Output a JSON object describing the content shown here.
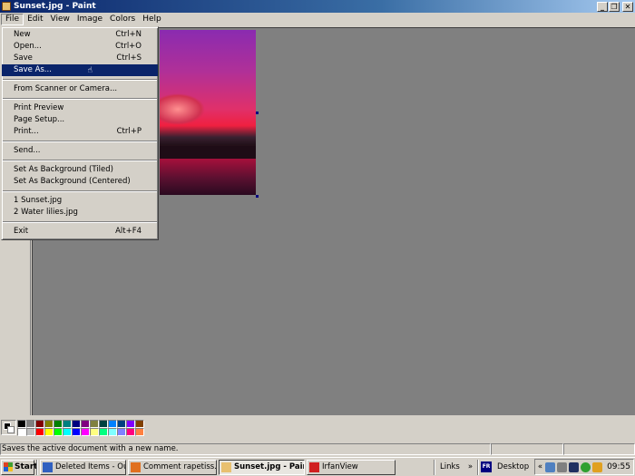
{
  "window": {
    "title": "Sunset.jpg - Paint"
  },
  "menubar": [
    "File",
    "Edit",
    "View",
    "Image",
    "Colors",
    "Help"
  ],
  "file_menu": {
    "groups": [
      [
        {
          "label": "New",
          "shortcut": "Ctrl+N"
        },
        {
          "label": "Open...",
          "shortcut": "Ctrl+O"
        },
        {
          "label": "Save",
          "shortcut": "Ctrl+S"
        },
        {
          "label": "Save As...",
          "shortcut": "",
          "highlighted": true
        }
      ],
      [
        {
          "label": "From Scanner or Camera...",
          "shortcut": ""
        }
      ],
      [
        {
          "label": "Print Preview",
          "shortcut": ""
        },
        {
          "label": "Page Setup...",
          "shortcut": ""
        },
        {
          "label": "Print...",
          "shortcut": "Ctrl+P"
        }
      ],
      [
        {
          "label": "Send...",
          "shortcut": ""
        }
      ],
      [
        {
          "label": "Set As Background (Tiled)",
          "shortcut": ""
        },
        {
          "label": "Set As Background (Centered)",
          "shortcut": ""
        }
      ],
      [
        {
          "label": "1 Sunset.jpg",
          "shortcut": ""
        },
        {
          "label": "2 Water lilies.jpg",
          "shortcut": ""
        }
      ],
      [
        {
          "label": "Exit",
          "shortcut": "Alt+F4"
        }
      ]
    ]
  },
  "palette": {
    "top": [
      "#000000",
      "#808080",
      "#800000",
      "#808000",
      "#008000",
      "#008080",
      "#000080",
      "#800080",
      "#808040",
      "#004040",
      "#0080ff",
      "#004080",
      "#8000ff",
      "#804000"
    ],
    "bottom": [
      "#ffffff",
      "#c0c0c0",
      "#ff0000",
      "#ffff00",
      "#00ff00",
      "#00ffff",
      "#0000ff",
      "#ff00ff",
      "#ffff80",
      "#00ff80",
      "#80ffff",
      "#8080ff",
      "#ff0080",
      "#ff8040"
    ]
  },
  "statusbar": {
    "message": "Saves the active document with a new name."
  },
  "taskbar": {
    "start": "Start",
    "tasks": [
      {
        "label": "Deleted Items - Ou...",
        "icon_color": "#3060c0",
        "active": false
      },
      {
        "label": "Comment rapetiss...",
        "icon_color": "#e07020",
        "active": false
      },
      {
        "label": "Sunset.jpg - Paint",
        "icon_color": "#e8c070",
        "active": true
      },
      {
        "label": "IrfanView",
        "icon_color": "#d02020",
        "active": false
      }
    ],
    "links": "Links",
    "chevron": "»",
    "language": "FR",
    "desktop": "Desktop",
    "tray_chevron": "«",
    "clock": "09:55"
  }
}
